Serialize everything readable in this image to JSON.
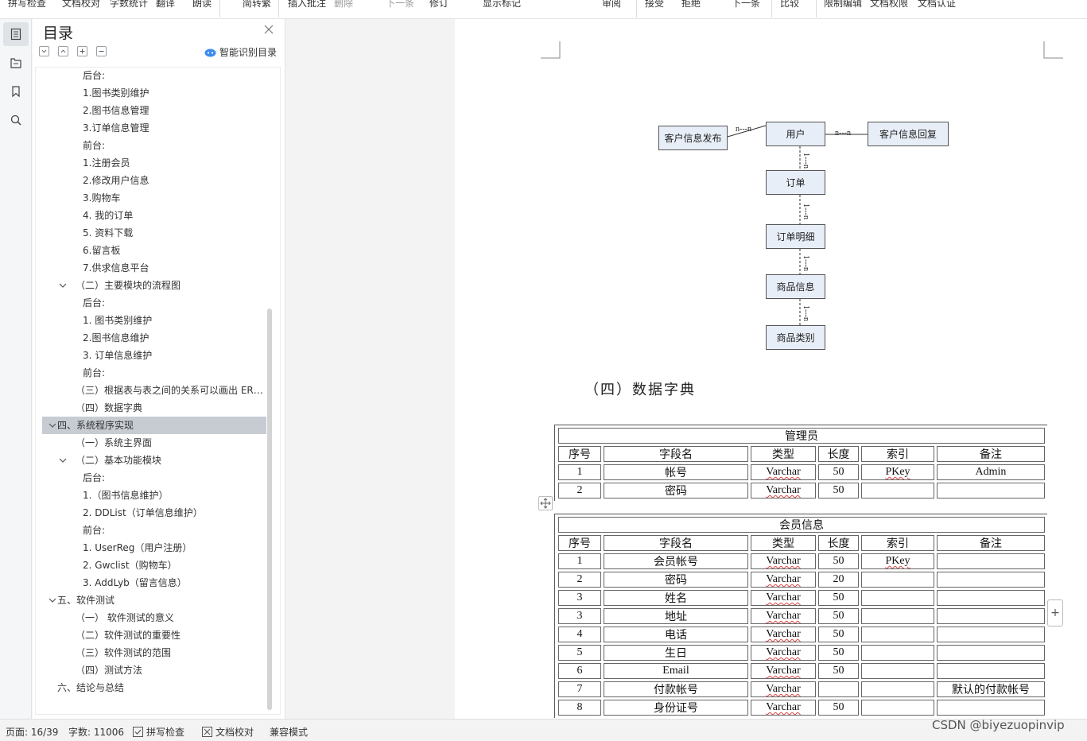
{
  "ribbon": {
    "items": [
      "拼写检查",
      "文档校对",
      "字数统计",
      "翻译",
      "朗读",
      "简转繁",
      "插入批注",
      "删除",
      "下一条",
      "修订",
      "显示标记",
      "审阅",
      "接受",
      "拒绝",
      "下一条",
      "比较",
      "限制编辑",
      "文档权限",
      "文档认证"
    ]
  },
  "rail": {
    "icons": [
      "toc-icon",
      "nav-icon",
      "bookmark-icon",
      "search-icon"
    ]
  },
  "toc": {
    "title": "目录",
    "smart_label": "智能识别目录",
    "items": [
      {
        "text": "后台:",
        "level": 3
      },
      {
        "text": "1.图书类别维护",
        "level": 3
      },
      {
        "text": "2.图书信息管理",
        "level": 3
      },
      {
        "text": "3.订单信息管理",
        "level": 3
      },
      {
        "text": "前台:",
        "level": 3
      },
      {
        "text": "1.注册会员",
        "level": 3
      },
      {
        "text": "2.修改用户信息",
        "level": 3
      },
      {
        "text": "3.购物车",
        "level": 3
      },
      {
        "text": "4. 我的订单",
        "level": 3
      },
      {
        "text": "5. 资料下载",
        "level": 3
      },
      {
        "text": "6.留言板",
        "level": 3
      },
      {
        "text": "7.供求信息平台",
        "level": 3
      },
      {
        "text": "（二）主要模块的流程图",
        "level": 2,
        "expanded": true
      },
      {
        "text": "后台:",
        "level": 3
      },
      {
        "text": "1. 图书类别维护",
        "level": 3
      },
      {
        "text": "2.图书信息维护",
        "level": 3
      },
      {
        "text": "3. 订单信息维护",
        "level": 3
      },
      {
        "text": "前台:",
        "level": 3
      },
      {
        "text": "（三）根据表与表之间的关系可以画出 ER 图如下：",
        "level": 2
      },
      {
        "text": "（四）数据字典",
        "level": 2
      },
      {
        "text": "四、系统程序实现",
        "level": 1,
        "expanded": true,
        "selected": true
      },
      {
        "text": "（一）系统主界面",
        "level": 2
      },
      {
        "text": "（二）基本功能模块",
        "level": 2,
        "expanded": true
      },
      {
        "text": "后台:",
        "level": 3
      },
      {
        "text": "1.（图书信息维护）",
        "level": 3
      },
      {
        "text": "2. DDList（订单信息维护）",
        "level": 3
      },
      {
        "text": "前台:",
        "level": 3
      },
      {
        "text": "1. UserReg（用户注册）",
        "level": 3
      },
      {
        "text": "2. Gwclist（购物车）",
        "level": 3
      },
      {
        "text": "3. AddLyb（留言信息）",
        "level": 3
      },
      {
        "text": "五、软件测试",
        "level": 1,
        "expanded": true
      },
      {
        "text": "（一）  软件测试的意义",
        "level": 2
      },
      {
        "text": "（二）软件测试的重要性",
        "level": 2
      },
      {
        "text": "（三）软件测试的范围",
        "level": 2
      },
      {
        "text": "（四）测试方法",
        "level": 2
      },
      {
        "text": "六、结论与总结",
        "level": 1
      }
    ]
  },
  "er": {
    "entities": {
      "publish": "客户信息发布",
      "user": "用户",
      "reply": "客户信息回复",
      "order": "订单",
      "detail": "订单明细",
      "goods": "商品信息",
      "category": "商品类别"
    },
    "rel_nn": "n---n",
    "rel_1n": "1---n"
  },
  "section_heading": "（四）数据字典",
  "tables": [
    {
      "title": "管理员",
      "headers": [
        "序号",
        "字段名",
        "类型",
        "长度",
        "索引",
        "备注"
      ],
      "rows": [
        [
          "1",
          "帐号",
          "Varchar",
          "50",
          "PKey",
          "Admin"
        ],
        [
          "2",
          "密码",
          "Varchar",
          "50",
          "",
          ""
        ]
      ]
    },
    {
      "title": "会员信息",
      "headers": [
        "序号",
        "字段名",
        "类型",
        "长度",
        "索引",
        "备注"
      ],
      "rows": [
        [
          "1",
          "会员帐号",
          "Varchar",
          "50",
          "PKey",
          ""
        ],
        [
          "2",
          "密码",
          "Varchar",
          "20",
          "",
          ""
        ],
        [
          "3",
          "姓名",
          "Varchar",
          "50",
          "",
          ""
        ],
        [
          "3",
          "地址",
          "Varchar",
          "50",
          "",
          ""
        ],
        [
          "4",
          "电话",
          "Varchar",
          "50",
          "",
          ""
        ],
        [
          "5",
          "生日",
          "Varchar",
          "50",
          "",
          ""
        ],
        [
          "6",
          "Email",
          "Varchar",
          "50",
          "",
          ""
        ],
        [
          "7",
          "付款帐号",
          "Varchar",
          "",
          "",
          "默认的付款帐号"
        ],
        [
          "8",
          "身份证号",
          "Varchar",
          "50",
          "",
          ""
        ]
      ]
    }
  ],
  "status": {
    "page": "页面: 16/39",
    "words": "字数: 11006",
    "spell": "拼写检查",
    "proof": "文档校对",
    "compat": "兼容模式"
  },
  "watermark": "CSDN @biyezuopinvip",
  "colors": {
    "toc_selected": "#c7ccd3",
    "er_fill": "#e8eef8",
    "accent": "#4a90e2"
  }
}
